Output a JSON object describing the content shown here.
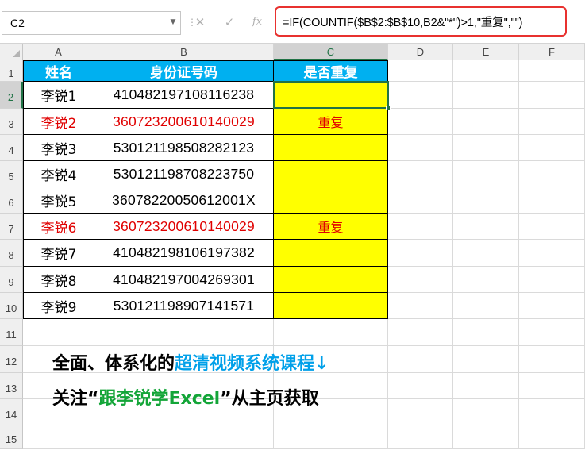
{
  "formula_bar": {
    "name_box": "C2",
    "name_box_arrow": "▼",
    "dots": "⋮",
    "cancel_icon": "✕",
    "enter_icon": "✓",
    "fx_label": "fx",
    "formula": "=IF(COUNTIF($B$2:$B$10,B2&\"*\")>1,\"重复\",\"\")"
  },
  "columns": [
    "A",
    "B",
    "C",
    "D",
    "E",
    "F"
  ],
  "rows": [
    "1",
    "2",
    "3",
    "4",
    "5",
    "6",
    "7",
    "8",
    "9",
    "10",
    "11",
    "12",
    "13",
    "14",
    "15"
  ],
  "table": {
    "headers": [
      "姓名",
      "身份证号码",
      "是否重复"
    ],
    "rows": [
      {
        "name": "李锐1",
        "id": "410482197108116238",
        "dup": ""
      },
      {
        "name": "李锐2",
        "id": "360723200610140029",
        "dup": "重复"
      },
      {
        "name": "李锐3",
        "id": "530121198508282123",
        "dup": ""
      },
      {
        "name": "李锐4",
        "id": "530121198708223750",
        "dup": ""
      },
      {
        "name": "李锐5",
        "id": "36078220050612001X",
        "dup": ""
      },
      {
        "name": "李锐6",
        "id": "360723200610140029",
        "dup": "重复"
      },
      {
        "name": "李锐7",
        "id": "410482198106197382",
        "dup": ""
      },
      {
        "name": "李锐8",
        "id": "410482197004269301",
        "dup": ""
      },
      {
        "name": "李锐9",
        "id": "530121198907141571",
        "dup": ""
      }
    ]
  },
  "promo": {
    "line1_black": "全面、体系化的",
    "line1_blue": "超清视频系统课程",
    "line1_arrow": "↓",
    "line2_black_a": "关注“",
    "line2_green": "跟李锐学Excel",
    "line2_black_b": "”从主页获取"
  },
  "colors": {
    "header_fill": "#00b0f0",
    "highlight_fill": "#ffff00",
    "duplicate_text": "#e00000",
    "selection": "#217346",
    "formula_outline": "#e8312f"
  }
}
